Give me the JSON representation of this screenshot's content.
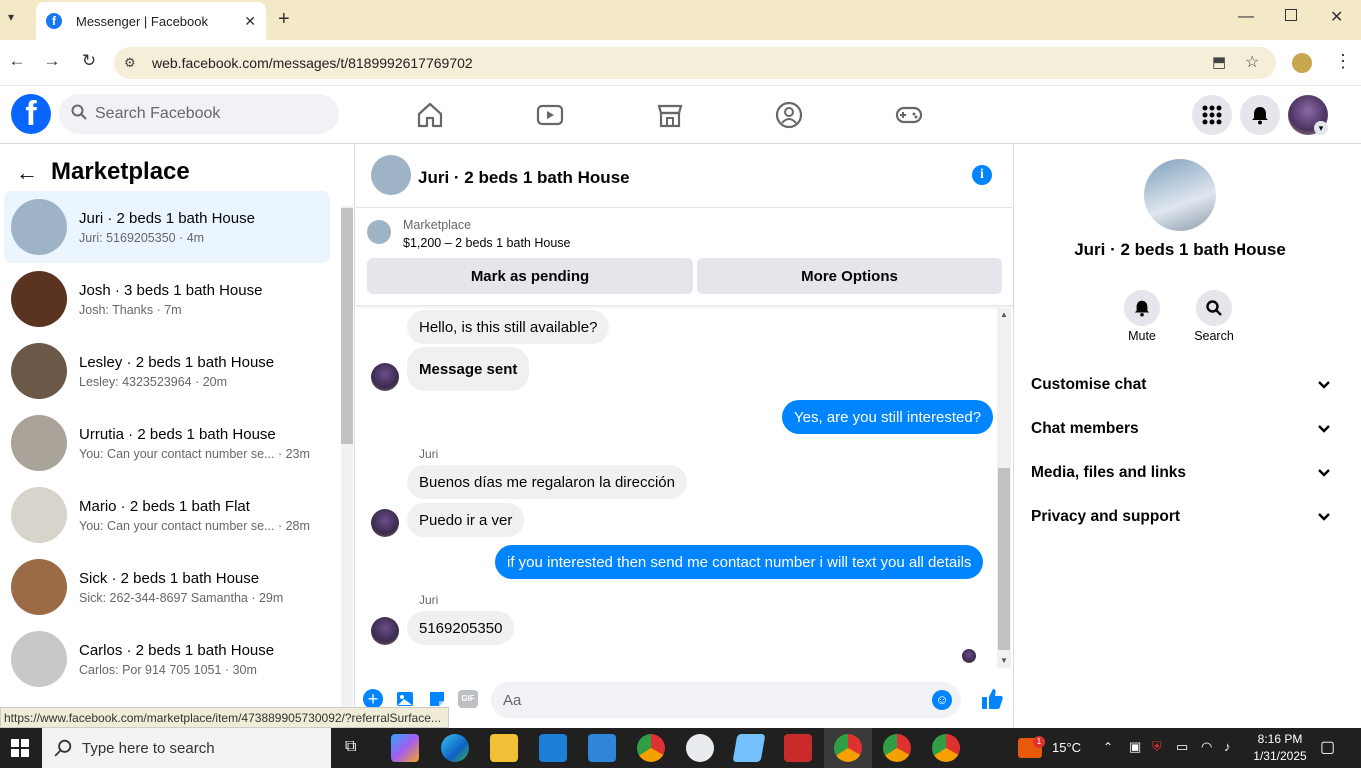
{
  "browser": {
    "tab_title": "Messenger | Facebook",
    "url": "web.facebook.com/messages/t/8189992617769702",
    "status_url": "https://www.facebook.com/marketplace/item/473889905730092/?referralSurface..."
  },
  "fb": {
    "search_placeholder": "Search Facebook",
    "brand_color": "#0866ff"
  },
  "sidebar": {
    "title": "Marketplace",
    "conversations": [
      {
        "name": "Juri · 2 beds 1 bath House",
        "preview": "Juri: 5169205350 · 4m",
        "color": "#9fb3c6"
      },
      {
        "name": "Josh · 3 beds 1 bath House",
        "preview": "Josh: Thanks · 7m",
        "color": "#5a3421"
      },
      {
        "name": "Lesley · 2 beds 1 bath House",
        "preview": "Lesley: 4323523964 · 20m",
        "color": "#6b5846"
      },
      {
        "name": "Urrutia · 2 beds 1 bath House",
        "preview": "You: Can your contact number se... · 23m",
        "color": "#a9a39a"
      },
      {
        "name": "Mario · 2 beds 1 bath Flat",
        "preview": "You: Can your contact number se... · 28m",
        "color": "#d8d4cc"
      },
      {
        "name": "Sick · 2 beds 1 bath House",
        "preview": "Sick: 262-344-8697 Samantha · 29m",
        "color": "#9b6a46"
      },
      {
        "name": "Carlos · 2 beds 1 bath House",
        "preview": "Carlos: Por 914 705 1051 · 30m",
        "color": "#c8c8c6"
      }
    ]
  },
  "chat": {
    "title": "Juri · 2 beds 1 bath House",
    "listing_label": "Marketplace",
    "listing_price": "$1,200 – 2 beds 1 bath House",
    "mark_pending": "Mark as pending",
    "more_options": "More Options",
    "messages": {
      "m1": "Hello, is this still available?",
      "m2": "Message sent",
      "m3": "Yes, are you still interested?",
      "sender1": "Juri",
      "m4": "Buenos días me regalaron la dirección",
      "m5": "Puedo ir a ver",
      "m6": "if you interested then send me contact number i will text you all details",
      "sender2": "Juri",
      "m7": "5169205350"
    },
    "composer_placeholder": "Aa",
    "gif_label": "GIF"
  },
  "details": {
    "title": "Juri · 2 beds 1 bath House",
    "mute": "Mute",
    "search": "Search",
    "sections": [
      "Customise chat",
      "Chat members",
      "Media, files and links",
      "Privacy and support"
    ]
  },
  "taskbar": {
    "search_placeholder": "Type here to search",
    "temperature": "15°C",
    "time": "8:16 PM",
    "date": "1/31/2025",
    "weather_badge": "1"
  }
}
